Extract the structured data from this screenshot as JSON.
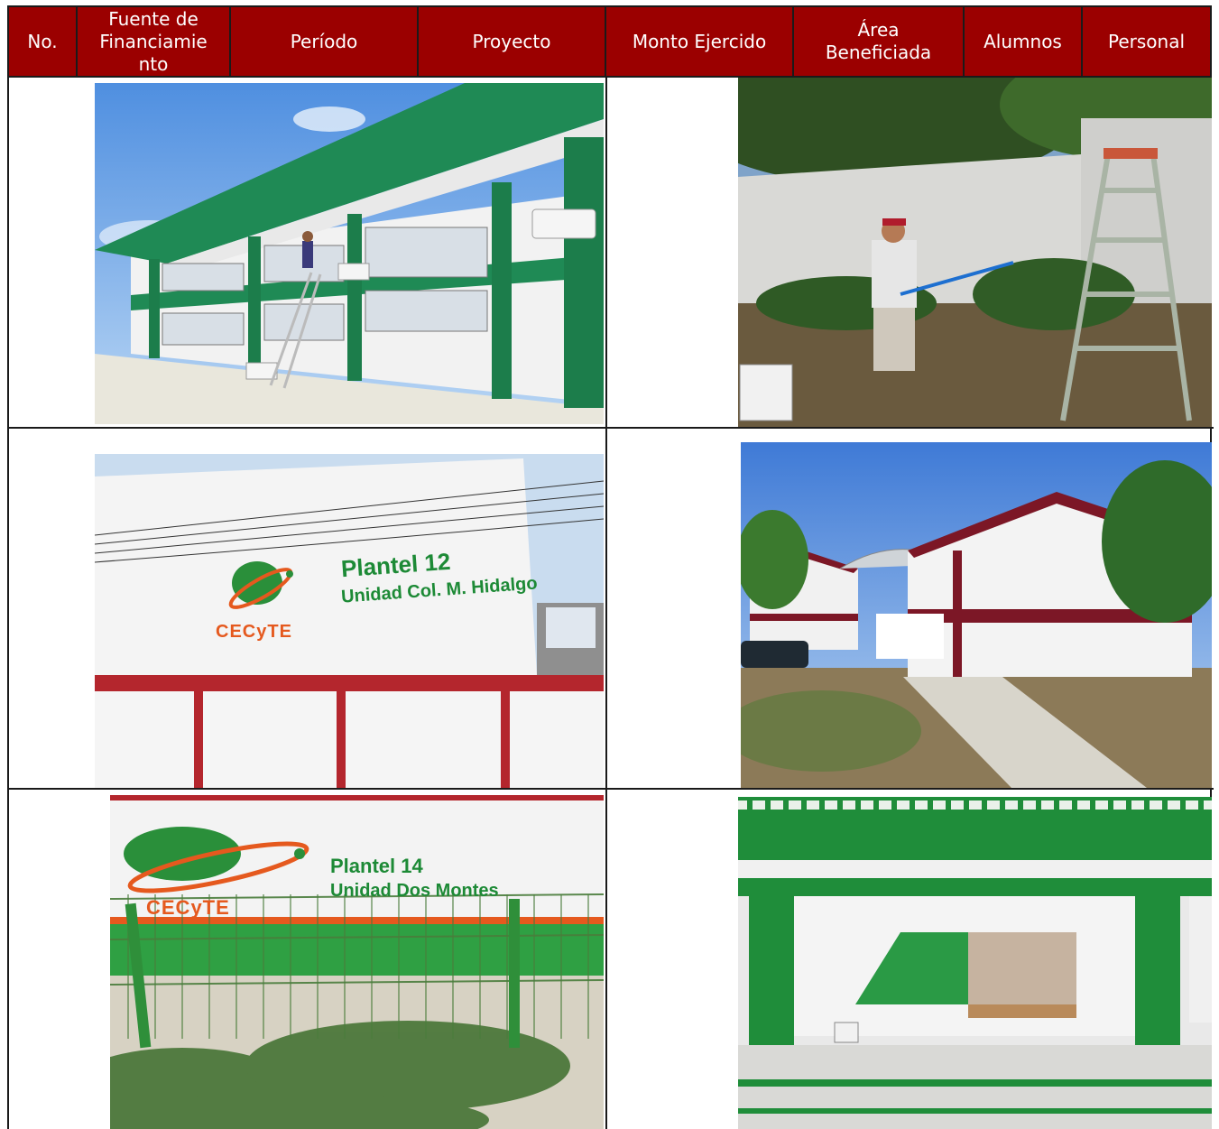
{
  "table": {
    "headers": [
      "No.",
      "Fuente de Financiamiento",
      "Período",
      "Proyecto",
      "Monto Ejercido",
      "Área Beneficiada",
      "Alumnos",
      "Personal"
    ],
    "header_lines": {
      "fuente": [
        "Fuente de",
        "Financiamie",
        "nto"
      ],
      "area": [
        "Área",
        "Beneficiada"
      ]
    }
  },
  "photos": {
    "p3": {
      "title": "Plantel 12",
      "subtitle": "Unidad Col. M. Hidalgo",
      "brand": "CECyTE"
    },
    "p5": {
      "title": "Plantel 14",
      "subtitle": "Unidad Dos Montes",
      "brand": "CECyTE"
    }
  },
  "colors": {
    "header_bg": "#9b0000",
    "header_text": "#ffffff",
    "school_green": "#1b8a4a",
    "school_maroon": "#7c1726"
  }
}
